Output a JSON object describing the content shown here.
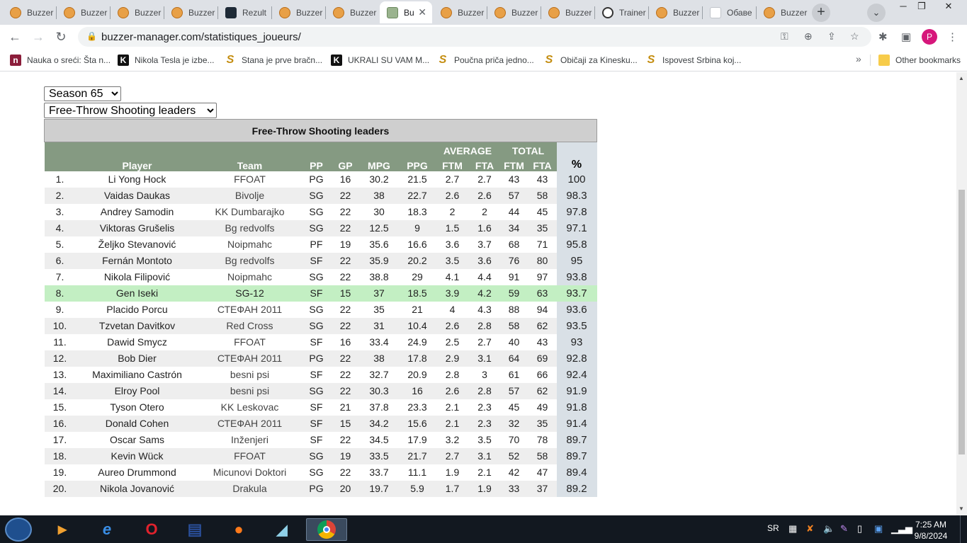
{
  "browser": {
    "tabs": [
      {
        "title": "Buzzer",
        "icon": "basketball-icon"
      },
      {
        "title": "Buzzer",
        "icon": "basketball-icon"
      },
      {
        "title": "Buzzer",
        "icon": "basketball-icon"
      },
      {
        "title": "Buzzer",
        "icon": "basketball-icon"
      },
      {
        "title": "Rezult",
        "icon": "rezultati-icon"
      },
      {
        "title": "Buzzer",
        "icon": "basketball-icon"
      },
      {
        "title": "Buzzer",
        "icon": "basketball-icon"
      },
      {
        "title": "Bu",
        "icon": "bm-icon",
        "active": true
      },
      {
        "title": "Buzzer",
        "icon": "basketball-icon"
      },
      {
        "title": "Buzzer",
        "icon": "basketball-icon"
      },
      {
        "title": "Buzzer",
        "icon": "basketball-icon"
      },
      {
        "title": "Trainer",
        "icon": "soccer-ball-icon"
      },
      {
        "title": "Buzzer",
        "icon": "basketball-icon"
      },
      {
        "title": "Обаве",
        "icon": "link-icon"
      },
      {
        "title": "Buzzer",
        "icon": "basketball-icon"
      }
    ],
    "new_tab": "+",
    "url": "buzzer-manager.com/statistiques_joueurs/",
    "profile_initial": "P",
    "bookmarks": [
      {
        "label": "Nauka o sreći: Šta n...",
        "icon": "n"
      },
      {
        "label": "Nikola Tesla je izbe...",
        "icon": "K"
      },
      {
        "label": "Stana je prve bračn...",
        "icon": "S"
      },
      {
        "label": "UKRALI SU VAM M...",
        "icon": "K"
      },
      {
        "label": "Poučna priča jedno...",
        "icon": "S"
      },
      {
        "label": "Običaji za Kinesku...",
        "icon": "S"
      },
      {
        "label": "Ispovest Srbina koj...",
        "icon": "S"
      }
    ],
    "bookmarks_more": "»",
    "other_bookmarks": "Other bookmarks"
  },
  "page": {
    "season_select": "Season 65",
    "category_select": "Free-Throw Shooting leaders",
    "table_caption": "Free-Throw Shooting leaders",
    "headers": {
      "player": "Player",
      "team": "Team",
      "pp": "PP",
      "gp": "GP",
      "mpg": "MPG",
      "ppg": "PPG",
      "average": "AVERAGE",
      "total": "TOTAL",
      "ftm": "FTM",
      "fta": "FTA",
      "pct": "%"
    },
    "rows": [
      [
        "1.",
        "Li Yong Hock",
        "FFOAT",
        "PG",
        "16",
        "30.2",
        "21.5",
        "2.7",
        "2.7",
        "43",
        "43",
        "100"
      ],
      [
        "2.",
        "Vaidas Daukas",
        "Bivolje",
        "SG",
        "22",
        "38",
        "22.7",
        "2.6",
        "2.6",
        "57",
        "58",
        "98.3"
      ],
      [
        "3.",
        "Andrey Samodin",
        "KK Dumbarajko",
        "SG",
        "22",
        "30",
        "18.3",
        "2",
        "2",
        "44",
        "45",
        "97.8"
      ],
      [
        "4.",
        "Viktoras Grušelis",
        "Bg redvolfs",
        "SG",
        "22",
        "12.5",
        "9",
        "1.5",
        "1.6",
        "34",
        "35",
        "97.1"
      ],
      [
        "5.",
        "Željko Stevanović",
        "Noipmahc",
        "PF",
        "19",
        "35.6",
        "16.6",
        "3.6",
        "3.7",
        "68",
        "71",
        "95.8"
      ],
      [
        "6.",
        "Fernán Montoto",
        "Bg redvolfs",
        "SF",
        "22",
        "35.9",
        "20.2",
        "3.5",
        "3.6",
        "76",
        "80",
        "95"
      ],
      [
        "7.",
        "Nikola Filipović",
        "Noipmahc",
        "SG",
        "22",
        "38.8",
        "29",
        "4.1",
        "4.4",
        "91",
        "97",
        "93.8"
      ],
      [
        "8.",
        "Gen Iseki",
        "SG-12",
        "SF",
        "15",
        "37",
        "18.5",
        "3.9",
        "4.2",
        "59",
        "63",
        "93.7"
      ],
      [
        "9.",
        "Placido Porcu",
        "СТЕФАН 2011",
        "SG",
        "22",
        "35",
        "21",
        "4",
        "4.3",
        "88",
        "94",
        "93.6"
      ],
      [
        "10.",
        "Tzvetan Davitkov",
        "Red Cross",
        "SG",
        "22",
        "31",
        "10.4",
        "2.6",
        "2.8",
        "58",
        "62",
        "93.5"
      ],
      [
        "11.",
        "Dawid Smycz",
        "FFOAT",
        "SF",
        "16",
        "33.4",
        "24.9",
        "2.5",
        "2.7",
        "40",
        "43",
        "93"
      ],
      [
        "12.",
        "Bob Dier",
        "СТЕФАН 2011",
        "PG",
        "22",
        "38",
        "17.8",
        "2.9",
        "3.1",
        "64",
        "69",
        "92.8"
      ],
      [
        "13.",
        "Maximiliano Castrón",
        "besni psi",
        "SF",
        "22",
        "32.7",
        "20.9",
        "2.8",
        "3",
        "61",
        "66",
        "92.4"
      ],
      [
        "14.",
        "Elroy Pool",
        "besni psi",
        "SG",
        "22",
        "30.3",
        "16",
        "2.6",
        "2.8",
        "57",
        "62",
        "91.9"
      ],
      [
        "15.",
        "Tyson Otero",
        "KK Leskovac",
        "SF",
        "21",
        "37.8",
        "23.3",
        "2.1",
        "2.3",
        "45",
        "49",
        "91.8"
      ],
      [
        "16.",
        "Donald Cohen",
        "СТЕФАН 2011",
        "SF",
        "15",
        "34.2",
        "15.6",
        "2.1",
        "2.3",
        "32",
        "35",
        "91.4"
      ],
      [
        "17.",
        "Oscar Sams",
        "Inženjeri",
        "SF",
        "22",
        "34.5",
        "17.9",
        "3.2",
        "3.5",
        "70",
        "78",
        "89.7"
      ],
      [
        "18.",
        "Kevin Wück",
        "FFOAT",
        "SG",
        "19",
        "33.5",
        "21.7",
        "2.7",
        "3.1",
        "52",
        "58",
        "89.7"
      ],
      [
        "19.",
        "Aureo Drummond",
        "Micunovi Doktori",
        "SG",
        "22",
        "33.7",
        "11.1",
        "1.9",
        "2.1",
        "42",
        "47",
        "89.4"
      ],
      [
        "20.",
        "Nikola Jovanović",
        "Drakula",
        "PG",
        "20",
        "19.7",
        "5.9",
        "1.7",
        "1.9",
        "33",
        "37",
        "89.2"
      ]
    ],
    "highlighted_row": 7,
    "colors": {
      "header_green": "#859a82",
      "highlight_green": "#c3efc3",
      "pct_column": "#d9e0e6"
    }
  },
  "taskbar": {
    "apps": [
      {
        "name": "media-player"
      },
      {
        "name": "internet-explorer"
      },
      {
        "name": "opera"
      },
      {
        "name": "save-floppy"
      },
      {
        "name": "firefox"
      },
      {
        "name": "notepad-app"
      },
      {
        "name": "chrome",
        "active": true
      }
    ],
    "language": "SR",
    "time": "7:25 AM",
    "date": "9/8/2024"
  }
}
